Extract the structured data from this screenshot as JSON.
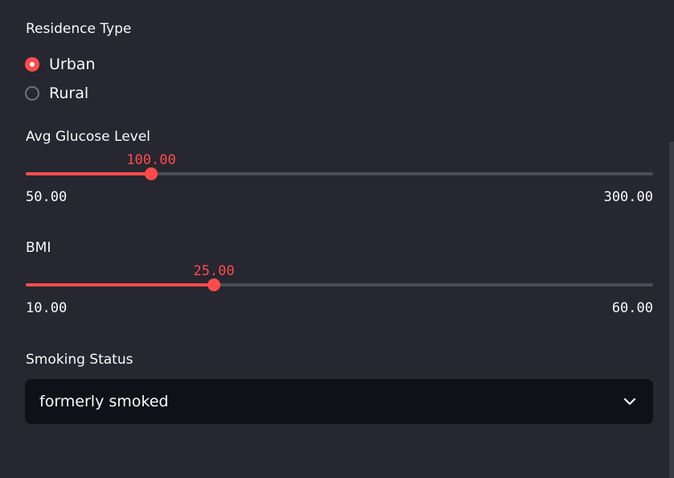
{
  "residence": {
    "label": "Residence Type",
    "options": [
      {
        "label": "Urban",
        "selected": true
      },
      {
        "label": "Rural",
        "selected": false
      }
    ]
  },
  "glucose": {
    "label": "Avg Glucose Level",
    "value": "100.00",
    "min": "50.00",
    "max": "300.00",
    "numeric": {
      "value": 100,
      "min": 50,
      "max": 300
    }
  },
  "bmi": {
    "label": "BMI",
    "value": "25.00",
    "min": "10.00",
    "max": "60.00",
    "numeric": {
      "value": 25,
      "min": 10,
      "max": 60
    }
  },
  "smoking": {
    "label": "Smoking Status",
    "selected": "formerly smoked"
  },
  "colors": {
    "accent": "#ff4b4b",
    "background": "#262730",
    "input_background": "#0e1117",
    "text": "#fafafa"
  },
  "icons": {
    "select_arrow": "chevron-down-icon"
  }
}
